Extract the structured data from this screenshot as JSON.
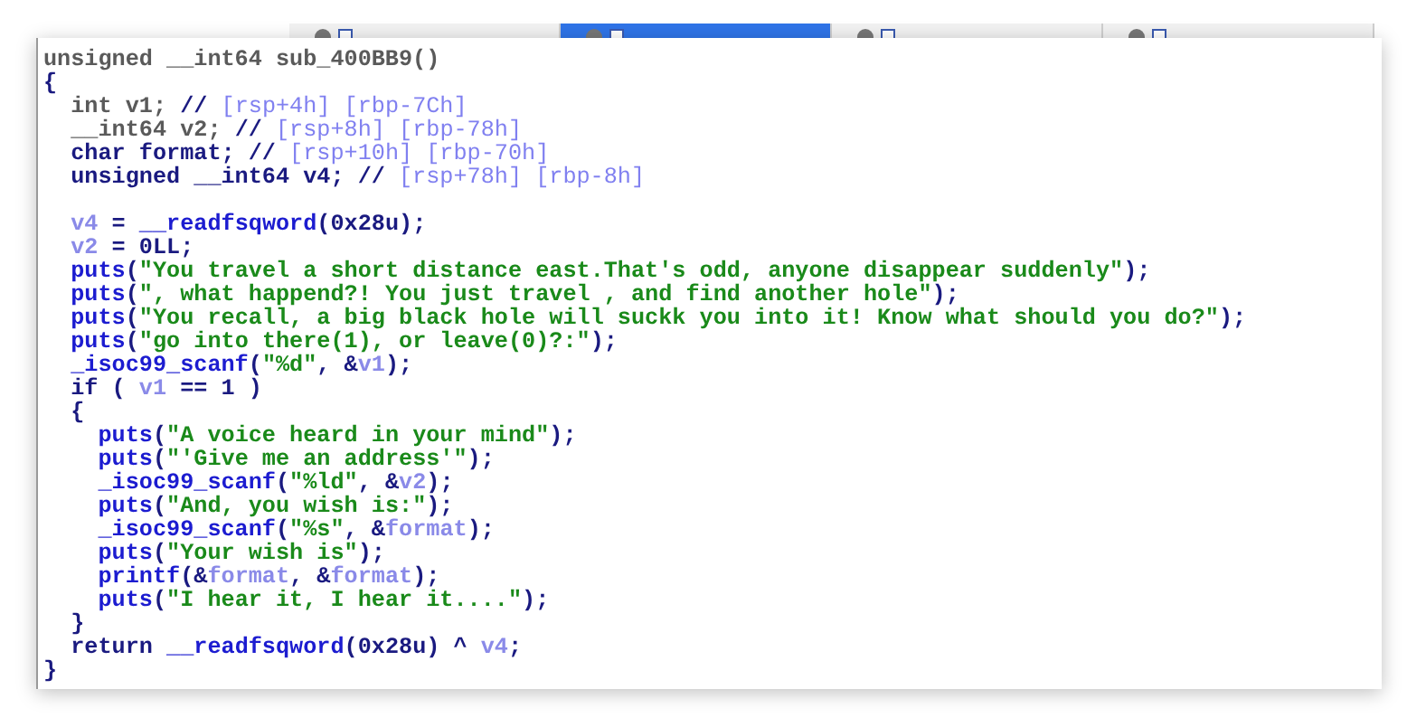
{
  "tabs": [
    {
      "selected": false
    },
    {
      "selected": true
    },
    {
      "selected": false
    },
    {
      "selected": false
    }
  ],
  "code": {
    "lines": [
      {
        "kind": "code",
        "tokens": [
          {
            "kind": "g",
            "text": "unsigned __int64 sub_400BB9()"
          }
        ]
      },
      {
        "kind": "code",
        "tokens": [
          {
            "kind": "t",
            "text": "{"
          }
        ]
      },
      {
        "kind": "code",
        "tokens": [
          {
            "kind": "g",
            "text": "  int v1; "
          },
          {
            "kind": "t",
            "text": "// "
          },
          {
            "kind": "c",
            "text": "[rsp+4h] [rbp-7Ch]"
          }
        ]
      },
      {
        "kind": "code",
        "tokens": [
          {
            "kind": "g",
            "text": "  __int64 v2; "
          },
          {
            "kind": "t",
            "text": "// "
          },
          {
            "kind": "c",
            "text": "[rsp+8h] [rbp-78h]"
          }
        ]
      },
      {
        "kind": "code",
        "tokens": [
          {
            "kind": "t",
            "text": "  char format; // "
          },
          {
            "kind": "c",
            "text": "[rsp+10h] [rbp-70h]"
          }
        ]
      },
      {
        "kind": "code",
        "tokens": [
          {
            "kind": "t",
            "text": "  unsigned __int64 v4; // "
          },
          {
            "kind": "c",
            "text": "[rsp+78h] [rbp-8h]"
          }
        ]
      },
      {
        "kind": "blank"
      },
      {
        "kind": "code",
        "tokens": [
          {
            "kind": "v",
            "text": "  v4"
          },
          {
            "kind": "t",
            "text": " = "
          },
          {
            "kind": "f",
            "text": "__readfsqword"
          },
          {
            "kind": "t",
            "text": "(0x28u);"
          }
        ]
      },
      {
        "kind": "code",
        "tokens": [
          {
            "kind": "v",
            "text": "  v2"
          },
          {
            "kind": "t",
            "text": " = 0LL;"
          }
        ]
      },
      {
        "kind": "code",
        "tokens": [
          {
            "kind": "f",
            "text": "  puts"
          },
          {
            "kind": "t",
            "text": "("
          },
          {
            "kind": "s",
            "text": "\"You travel a short distance east.That's odd, anyone disappear suddenly\""
          },
          {
            "kind": "t",
            "text": ");"
          }
        ]
      },
      {
        "kind": "code",
        "tokens": [
          {
            "kind": "f",
            "text": "  puts"
          },
          {
            "kind": "t",
            "text": "("
          },
          {
            "kind": "s",
            "text": "\", what happend?! You just travel , and find another hole\""
          },
          {
            "kind": "t",
            "text": ");"
          }
        ]
      },
      {
        "kind": "code",
        "tokens": [
          {
            "kind": "f",
            "text": "  puts"
          },
          {
            "kind": "t",
            "text": "("
          },
          {
            "kind": "s",
            "text": "\"You recall, a big black hole will suckk you into it! Know what should you do?\""
          },
          {
            "kind": "t",
            "text": ");"
          }
        ]
      },
      {
        "kind": "code",
        "tokens": [
          {
            "kind": "f",
            "text": "  puts"
          },
          {
            "kind": "t",
            "text": "("
          },
          {
            "kind": "s",
            "text": "\"go into there(1), or leave(0)?:\""
          },
          {
            "kind": "t",
            "text": ");"
          }
        ]
      },
      {
        "kind": "code",
        "tokens": [
          {
            "kind": "f",
            "text": "  _isoc99_scanf"
          },
          {
            "kind": "t",
            "text": "("
          },
          {
            "kind": "s",
            "text": "\"%d\""
          },
          {
            "kind": "t",
            "text": ", &"
          },
          {
            "kind": "v",
            "text": "v1"
          },
          {
            "kind": "t",
            "text": ");"
          }
        ]
      },
      {
        "kind": "code",
        "tokens": [
          {
            "kind": "t",
            "text": "  if ( "
          },
          {
            "kind": "v",
            "text": "v1"
          },
          {
            "kind": "t",
            "text": " == 1 )"
          }
        ]
      },
      {
        "kind": "code",
        "tokens": [
          {
            "kind": "t",
            "text": "  {"
          }
        ]
      },
      {
        "kind": "code",
        "tokens": [
          {
            "kind": "f",
            "text": "    puts"
          },
          {
            "kind": "t",
            "text": "("
          },
          {
            "kind": "s",
            "text": "\"A voice heard in your mind\""
          },
          {
            "kind": "t",
            "text": ");"
          }
        ]
      },
      {
        "kind": "code",
        "tokens": [
          {
            "kind": "f",
            "text": "    puts"
          },
          {
            "kind": "t",
            "text": "("
          },
          {
            "kind": "s",
            "text": "\"'Give me an address'\""
          },
          {
            "kind": "t",
            "text": ");"
          }
        ]
      },
      {
        "kind": "code",
        "tokens": [
          {
            "kind": "f",
            "text": "    _isoc99_scanf"
          },
          {
            "kind": "t",
            "text": "("
          },
          {
            "kind": "s",
            "text": "\"%ld\""
          },
          {
            "kind": "t",
            "text": ", &"
          },
          {
            "kind": "v",
            "text": "v2"
          },
          {
            "kind": "t",
            "text": ");"
          }
        ]
      },
      {
        "kind": "code",
        "tokens": [
          {
            "kind": "f",
            "text": "    puts"
          },
          {
            "kind": "t",
            "text": "("
          },
          {
            "kind": "s",
            "text": "\"And, you wish is:\""
          },
          {
            "kind": "t",
            "text": ");"
          }
        ]
      },
      {
        "kind": "code",
        "tokens": [
          {
            "kind": "f",
            "text": "    _isoc99_scanf"
          },
          {
            "kind": "t",
            "text": "("
          },
          {
            "kind": "s",
            "text": "\"%s\""
          },
          {
            "kind": "t",
            "text": ", &"
          },
          {
            "kind": "v",
            "text": "format"
          },
          {
            "kind": "t",
            "text": ");"
          }
        ]
      },
      {
        "kind": "code",
        "tokens": [
          {
            "kind": "f",
            "text": "    puts"
          },
          {
            "kind": "t",
            "text": "("
          },
          {
            "kind": "s",
            "text": "\"Your wish is\""
          },
          {
            "kind": "t",
            "text": ");"
          }
        ]
      },
      {
        "kind": "code",
        "tokens": [
          {
            "kind": "f",
            "text": "    printf"
          },
          {
            "kind": "t",
            "text": "(&"
          },
          {
            "kind": "v",
            "text": "format"
          },
          {
            "kind": "t",
            "text": ", &"
          },
          {
            "kind": "v",
            "text": "format"
          },
          {
            "kind": "t",
            "text": ");"
          }
        ]
      },
      {
        "kind": "code",
        "tokens": [
          {
            "kind": "f",
            "text": "    puts"
          },
          {
            "kind": "t",
            "text": "("
          },
          {
            "kind": "s",
            "text": "\"I hear it, I hear it....\""
          },
          {
            "kind": "t",
            "text": ");"
          }
        ]
      },
      {
        "kind": "code",
        "tokens": [
          {
            "kind": "t",
            "text": "  }"
          }
        ]
      },
      {
        "kind": "code",
        "tokens": [
          {
            "kind": "t",
            "text": "  return "
          },
          {
            "kind": "f",
            "text": "__readfsqword"
          },
          {
            "kind": "t",
            "text": "(0x28u) ^ "
          },
          {
            "kind": "v",
            "text": "v4"
          },
          {
            "kind": "t",
            "text": ";"
          }
        ]
      },
      {
        "kind": "code",
        "tokens": [
          {
            "kind": "t",
            "text": "}"
          }
        ]
      }
    ]
  }
}
